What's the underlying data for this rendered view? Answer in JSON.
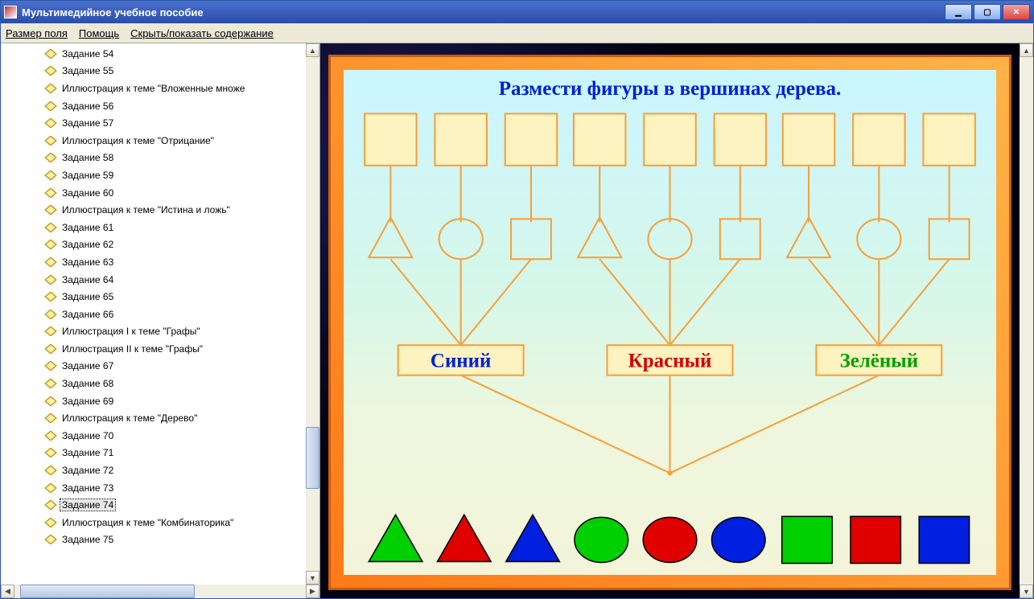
{
  "window": {
    "title": "Мультимедийное учебное пособие"
  },
  "menu": {
    "field_size": "Размер поля",
    "help": "Помощь",
    "toggle_toc": "Скрыть/показать содержание"
  },
  "sidebar": {
    "items": [
      {
        "label": "Задание 54"
      },
      {
        "label": "Задание 55"
      },
      {
        "label": "Иллюстрация к теме \"Вложенные множе"
      },
      {
        "label": "Задание 56"
      },
      {
        "label": "Задание 57"
      },
      {
        "label": "Иллюстрация к теме \"Отрицание\""
      },
      {
        "label": "Задание 58"
      },
      {
        "label": "Задание 59"
      },
      {
        "label": "Задание 60"
      },
      {
        "label": "Иллюстрация к теме \"Истина и ложь\""
      },
      {
        "label": "Задание 61"
      },
      {
        "label": "Задание 62"
      },
      {
        "label": "Задание 63"
      },
      {
        "label": "Задание 64"
      },
      {
        "label": "Задание 65"
      },
      {
        "label": "Задание 66"
      },
      {
        "label": "Иллюстрация I к теме \"Графы\""
      },
      {
        "label": "Иллюстрация II к теме \"Графы\""
      },
      {
        "label": "Задание 67"
      },
      {
        "label": "Задание 68"
      },
      {
        "label": "Задание 69"
      },
      {
        "label": "Иллюстрация к теме \"Дерево\""
      },
      {
        "label": "Задание 70"
      },
      {
        "label": "Задание 71"
      },
      {
        "label": "Задание 72"
      },
      {
        "label": "Задание 73"
      },
      {
        "label": "Задание 74",
        "selected": true
      },
      {
        "label": "Иллюстрация к теме \"Комбинаторика\""
      },
      {
        "label": "Задание 75"
      }
    ]
  },
  "stage": {
    "title": "Размести фигуры в вершинах дерева.",
    "color_nodes": [
      {
        "label": "Синий",
        "color": "#0020d4"
      },
      {
        "label": "Красный",
        "color": "#d40000"
      },
      {
        "label": "Зелёный",
        "color": "#00a000"
      }
    ],
    "shape_nodes_per_branch": [
      "triangle",
      "circle",
      "square"
    ],
    "palette": [
      {
        "shape": "triangle",
        "fill": "#00d000"
      },
      {
        "shape": "triangle",
        "fill": "#e00000"
      },
      {
        "shape": "triangle",
        "fill": "#0020e0"
      },
      {
        "shape": "circle",
        "fill": "#00d000"
      },
      {
        "shape": "circle",
        "fill": "#e00000"
      },
      {
        "shape": "circle",
        "fill": "#0020e0"
      },
      {
        "shape": "square",
        "fill": "#00d000"
      },
      {
        "shape": "square",
        "fill": "#e00000"
      },
      {
        "shape": "square",
        "fill": "#0020e0"
      }
    ]
  },
  "colors": {
    "orange_stroke": "#f7a13a",
    "slot_fill": "#fdf3c1"
  }
}
